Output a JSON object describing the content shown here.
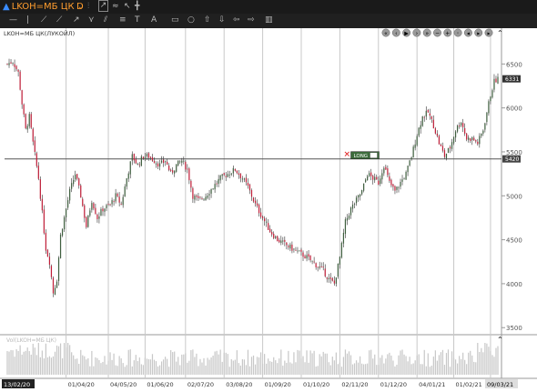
{
  "header": {
    "symbol": "LKOH=МБ ЦК",
    "period": "D"
  },
  "toolbar_icons": [
    "line-tool-icon",
    "vertical-line-icon",
    "trendline-icon",
    "ray-icon",
    "arrow-line-icon",
    "fork-icon",
    "pitchfork-icon",
    "fibonacci-icon",
    "text-icon",
    "label-icon",
    "rectangle-icon",
    "ellipse-icon",
    "arrow-up-icon",
    "arrow-down-icon",
    "arrow-left-icon",
    "arrow-right-icon",
    "trash-icon"
  ],
  "chart_data": {
    "type": "candlestick",
    "title": "LKOH=МБ ЦК(ЛУКОЙЛ)",
    "volume_title": "Vol(LKOH=МБ ЦК)",
    "y_ticks": [
      3500,
      4000,
      4500,
      5000,
      5500,
      6000,
      6500
    ],
    "ylim": [
      3430,
      6700
    ],
    "current_price_label": "6331",
    "level_label": "5420",
    "level_value": 5420,
    "order_label": "LONG",
    "x_labels": [
      "13/02/20",
      "01/04/20",
      "04/05/20",
      "01/06/20",
      "02/07/20",
      "03/08/20",
      "01/09/20",
      "01/10/20",
      "02/11/20",
      "01/12/20",
      "04/01/21",
      "01/02/21",
      "09/03/21"
    ],
    "x_label_index": [
      0,
      32,
      55,
      75,
      97,
      118,
      139,
      160,
      181,
      202,
      223,
      243,
      263
    ],
    "n_bars": 268,
    "anchors": [
      [
        0,
        6500
      ],
      [
        3,
        6530
      ],
      [
        6,
        6400
      ],
      [
        8,
        6050
      ],
      [
        10,
        5750
      ],
      [
        12,
        5900
      ],
      [
        14,
        5600
      ],
      [
        17,
        5200
      ],
      [
        19,
        4800
      ],
      [
        21,
        4400
      ],
      [
        23,
        4250
      ],
      [
        25,
        3900
      ],
      [
        27,
        4050
      ],
      [
        29,
        4550
      ],
      [
        31,
        4750
      ],
      [
        34,
        5050
      ],
      [
        37,
        5250
      ],
      [
        40,
        5000
      ],
      [
        43,
        4650
      ],
      [
        46,
        4950
      ],
      [
        49,
        4750
      ],
      [
        52,
        4850
      ],
      [
        56,
        4900
      ],
      [
        59,
        5000
      ],
      [
        62,
        4900
      ],
      [
        65,
        5200
      ],
      [
        68,
        5450
      ],
      [
        71,
        5350
      ],
      [
        74,
        5450
      ],
      [
        77,
        5450
      ],
      [
        80,
        5400
      ],
      [
        83,
        5350
      ],
      [
        86,
        5400
      ],
      [
        89,
        5250
      ],
      [
        92,
        5350
      ],
      [
        95,
        5400
      ],
      [
        98,
        5300
      ],
      [
        101,
        5000
      ],
      [
        104,
        4950
      ],
      [
        108,
        5000
      ],
      [
        112,
        5100
      ],
      [
        116,
        5200
      ],
      [
        120,
        5250
      ],
      [
        124,
        5300
      ],
      [
        128,
        5200
      ],
      [
        131,
        5100
      ],
      [
        135,
        4900
      ],
      [
        139,
        4750
      ],
      [
        143,
        4600
      ],
      [
        147,
        4500
      ],
      [
        151,
        4450
      ],
      [
        155,
        4400
      ],
      [
        159,
        4350
      ],
      [
        163,
        4300
      ],
      [
        166,
        4250
      ],
      [
        169,
        4200
      ],
      [
        172,
        4150
      ],
      [
        175,
        4050
      ],
      [
        178,
        4000
      ],
      [
        181,
        4300
      ],
      [
        184,
        4700
      ],
      [
        187,
        4850
      ],
      [
        190,
        4950
      ],
      [
        193,
        5050
      ],
      [
        196,
        5250
      ],
      [
        199,
        5200
      ],
      [
        202,
        5150
      ],
      [
        205,
        5350
      ],
      [
        208,
        5150
      ],
      [
        211,
        5050
      ],
      [
        214,
        5150
      ],
      [
        217,
        5250
      ],
      [
        220,
        5450
      ],
      [
        223,
        5700
      ],
      [
        226,
        5900
      ],
      [
        229,
        5950
      ],
      [
        232,
        5800
      ],
      [
        235,
        5600
      ],
      [
        238,
        5450
      ],
      [
        241,
        5550
      ],
      [
        244,
        5750
      ],
      [
        247,
        5850
      ],
      [
        250,
        5650
      ],
      [
        253,
        5650
      ],
      [
        256,
        5600
      ],
      [
        259,
        5750
      ],
      [
        261,
        5950
      ],
      [
        263,
        6150
      ],
      [
        265,
        6300
      ],
      [
        267,
        6331
      ]
    ],
    "vertical_grid_index": [
      32,
      55,
      75,
      97,
      118,
      139,
      160,
      181,
      202,
      223,
      243,
      263
    ]
  }
}
